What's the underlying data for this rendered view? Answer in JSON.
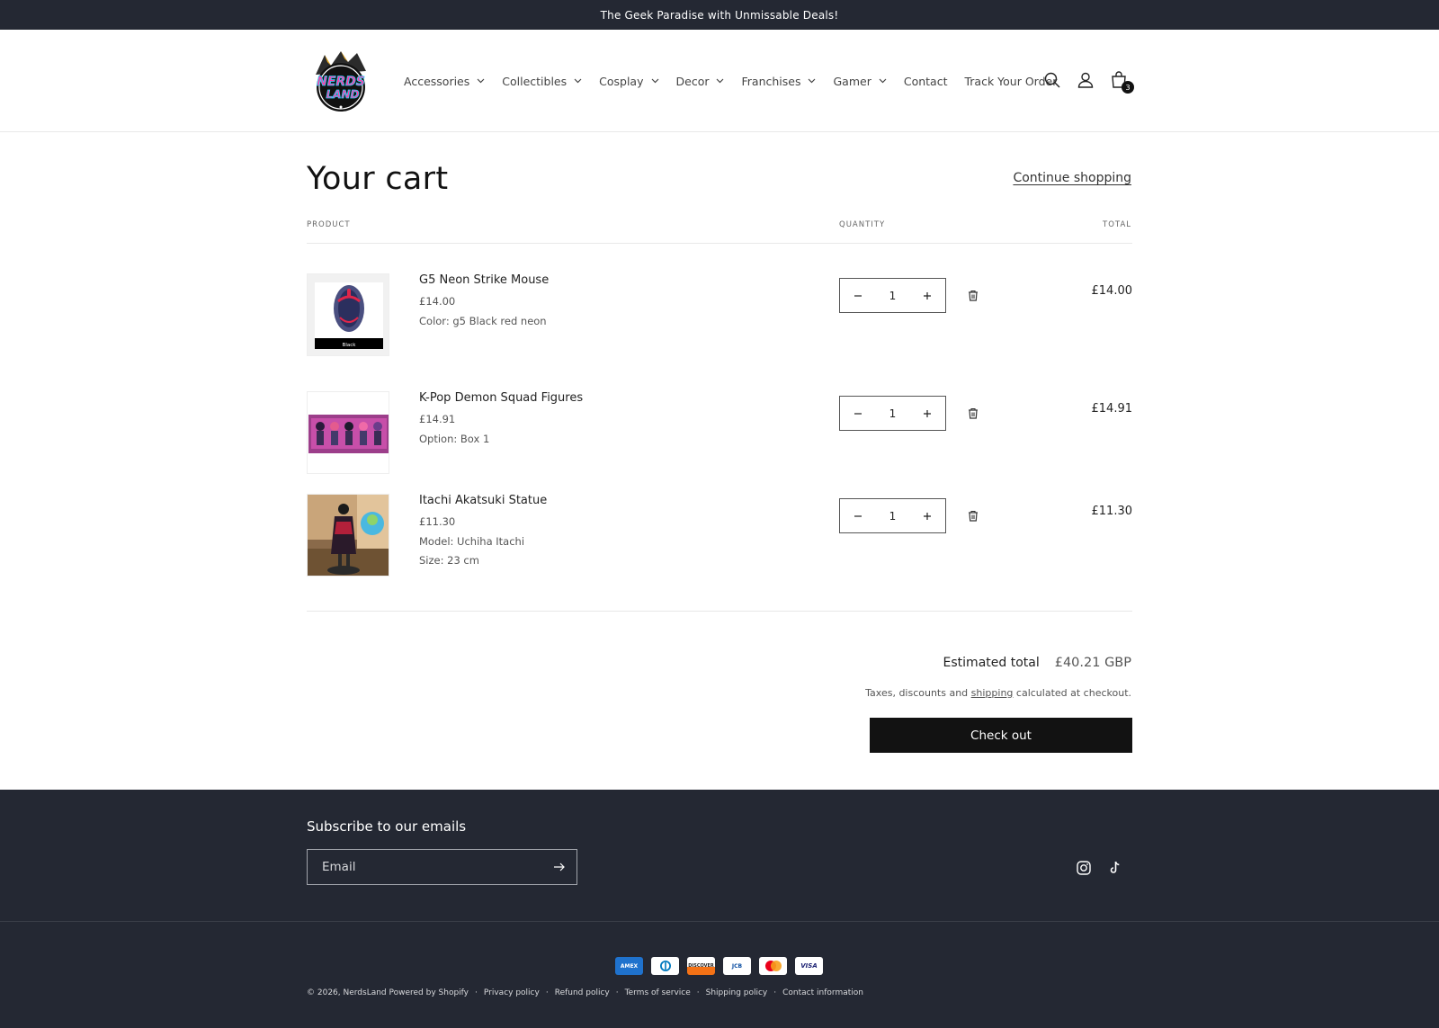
{
  "announcement": "The Geek Paradise with Unmissable Deals!",
  "logo": {
    "alt": "NERDS LAND"
  },
  "nav": [
    {
      "label": "Accessories",
      "dropdown": true
    },
    {
      "label": "Collectibles",
      "dropdown": true
    },
    {
      "label": "Cosplay",
      "dropdown": true
    },
    {
      "label": "Decor",
      "dropdown": true
    },
    {
      "label": "Franchises",
      "dropdown": true
    },
    {
      "label": "Gamer",
      "dropdown": true
    },
    {
      "label": "Contact",
      "dropdown": false
    },
    {
      "label": "Track Your Order",
      "dropdown": false
    }
  ],
  "header_icons": {
    "search": "search-icon",
    "account": "account-icon",
    "cart": "cart-icon",
    "cart_count": "3"
  },
  "cart": {
    "title": "Your cart",
    "continue_label": "Continue shopping",
    "columns": {
      "product": "PRODUCT",
      "quantity": "QUANTITY",
      "total": "TOTAL"
    },
    "items": [
      {
        "name": "G5 Neon Strike Mouse",
        "price": "£14.00",
        "options": [
          "Color: g5 Black red neon"
        ],
        "quantity": "1",
        "total": "£14.00",
        "thumb_label": "Black"
      },
      {
        "name": "K-Pop Demon Squad Figures",
        "price": "£14.91",
        "options": [
          "Option: Box 1"
        ],
        "quantity": "1",
        "total": "£14.91"
      },
      {
        "name": "Itachi Akatsuki Statue",
        "price": "£11.30",
        "options": [
          "Model: Uchiha Itachi",
          "Size: 23 cm"
        ],
        "quantity": "1",
        "total": "£11.30"
      }
    ],
    "estimated_label": "Estimated total",
    "estimated_value": "£40.21 GBP",
    "tax_pre": "Taxes, discounts and ",
    "tax_link": "shipping",
    "tax_post": " calculated at checkout.",
    "checkout_label": "Check out"
  },
  "footer": {
    "subscribe_title": "Subscribe to our emails",
    "email_placeholder": "Email",
    "social": [
      "instagram-icon",
      "tiktok-icon"
    ],
    "payments": [
      "American Express",
      "Diners Club",
      "Discover",
      "JCB",
      "Mastercard",
      "Visa"
    ],
    "payment_marks": {
      "amex": "AMEX",
      "discover": "DISCOVER",
      "jcb": "JCB",
      "visa": "VISA"
    },
    "copyright": "© 2026, NerdsLand Powered by Shopify",
    "links": [
      "Privacy policy",
      "Refund policy",
      "Terms of service",
      "Shipping policy",
      "Contact information"
    ]
  },
  "colors": {
    "dark": "#242833",
    "button": "#121212",
    "text": "#222222"
  }
}
